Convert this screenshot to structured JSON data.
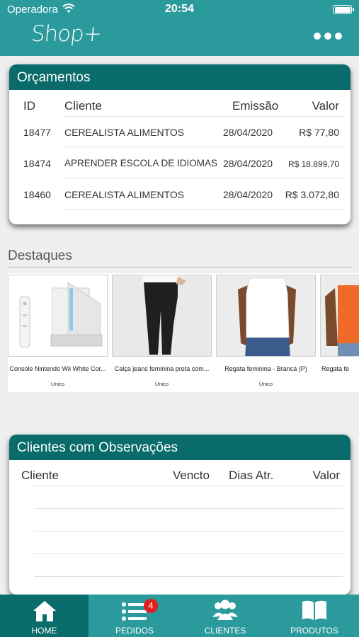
{
  "status": {
    "carrier": "Operadora",
    "time": "20:54"
  },
  "header": {
    "logo": "Shop+"
  },
  "orcamentos": {
    "title": "Orçamentos",
    "columns": [
      "ID",
      "Cliente",
      "Emissão",
      "Valor"
    ],
    "rows": [
      {
        "id": "18477",
        "cliente": "CEREALISTA ALIMENTOS",
        "emissao": "28/04/2020",
        "valor": "R$ 77,80"
      },
      {
        "id": "18474",
        "cliente": "APRENDER ESCOLA DE IDIOMAS",
        "emissao": "28/04/2020",
        "valor": "R$ 18.899,70"
      },
      {
        "id": "18460",
        "cliente": "CEREALISTA ALIMENTOS",
        "emissao": "28/04/2020",
        "valor": "R$ 3.072,80"
      }
    ]
  },
  "destaques": {
    "title": "Destaques",
    "products": [
      {
        "name": "Console Nintendo Wii White Cor...",
        "variant": "Unico"
      },
      {
        "name": "Calça jeans feminina preta com...",
        "variant": "Unico"
      },
      {
        "name": "Regata feminina - Branca (P)",
        "variant": "Unico"
      },
      {
        "name": "Regata fe",
        "variant": ""
      }
    ]
  },
  "clientes_obs": {
    "title": "Clientes com Observações",
    "columns": [
      "Cliente",
      "Vencto",
      "Dias Atr.",
      "Valor"
    ]
  },
  "tabbar": {
    "tabs": [
      {
        "label": "HOME",
        "icon": "home-icon"
      },
      {
        "label": "PEDIDOS",
        "icon": "list-icon"
      },
      {
        "label": "CLIENTES",
        "icon": "users-icon"
      },
      {
        "label": "PRODUTOS",
        "icon": "book-icon"
      }
    ],
    "pedidos_badge": "4"
  },
  "colors": {
    "primary": "#2a9a9d",
    "primary_dark": "#0a6b6b",
    "badge": "#e31d1d"
  }
}
